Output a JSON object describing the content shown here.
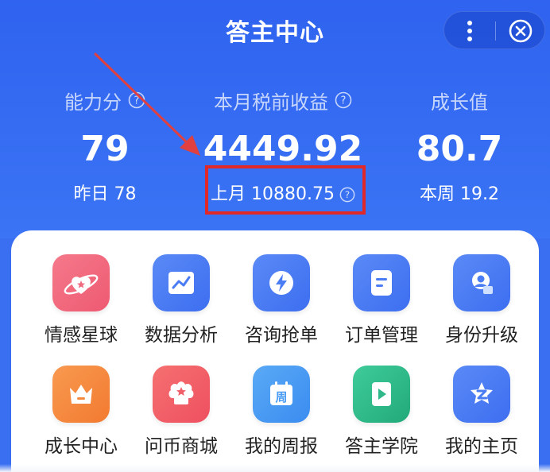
{
  "header": {
    "title": "答主中心"
  },
  "stats": [
    {
      "label": "能力分",
      "value": "79",
      "sub": "昨日 78",
      "has_help": true
    },
    {
      "label": "本月税前收益",
      "value": "4449.92",
      "sub": "上月 10880.75",
      "has_help": true,
      "sub_has_help": true
    },
    {
      "label": "成长值",
      "value": "80.7",
      "sub": "本周 19.2",
      "has_help": false
    }
  ],
  "grid": [
    {
      "label": "情感星球",
      "icon": "planet-heart-icon",
      "color": "#f06a7f"
    },
    {
      "label": "数据分析",
      "icon": "chart-icon",
      "color": "#4a7cf4"
    },
    {
      "label": "咨询抢单",
      "icon": "lightning-icon",
      "color": "#4a7cf4"
    },
    {
      "label": "订单管理",
      "icon": "document-icon",
      "color": "#4a7cf4"
    },
    {
      "label": "身份升级",
      "icon": "user-badge-icon",
      "color": "#4a7cf4"
    },
    {
      "label": "成长中心",
      "icon": "crown-icon",
      "color": "#f58a3e"
    },
    {
      "label": "问币商城",
      "icon": "shop-star-icon",
      "color": "#f0606a"
    },
    {
      "label": "我的周报",
      "icon": "calendar-icon",
      "color": "#4a9cf4"
    },
    {
      "label": "答主学院",
      "icon": "play-icon",
      "color": "#2fb88a"
    },
    {
      "label": "我的主页",
      "icon": "home-z-icon",
      "color": "#4a7cf4"
    }
  ],
  "calendar_icon_text": "周",
  "colors": {
    "header_bg": "#2f63f0",
    "highlight": "#e02828",
    "arrow": "#e04040"
  }
}
